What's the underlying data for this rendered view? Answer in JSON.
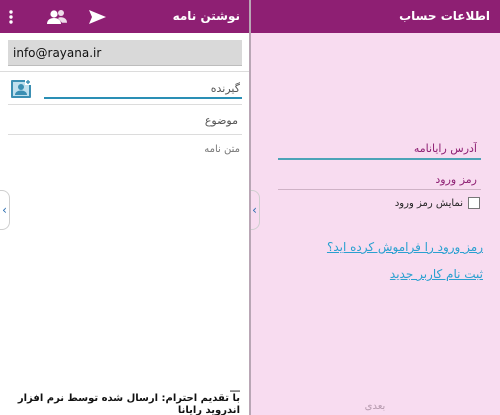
{
  "compose": {
    "title": "نوشتن نامه",
    "from_value": "info@rayana.ir",
    "to_placeholder": "گیرنده",
    "subject_placeholder": "موضوع",
    "body_placeholder": "متن نامه",
    "signature_line1": "__",
    "signature_line2": "با تقدیم احترام: ارسال شده توسط نرم افزار",
    "signature_line3": "اندروید رایانا"
  },
  "login": {
    "title": "اطلاعات حساب",
    "email_placeholder": "آدرس رایانامه",
    "password_placeholder": "رمز ورود",
    "show_password_label": "نمایش رمز ورود",
    "forgot_link": "رمز ورود را فراموش کرده اید؟",
    "register_link": "ثبت نام کاربر جدید",
    "next_button": "بعدی"
  },
  "edge_tab_glyph": "‹",
  "colors": {
    "appbar": "#8e1f73",
    "login_bg": "#f8dcf0",
    "link": "#2aa0d0",
    "accent_underline": "#2a8fb5"
  },
  "icons": [
    "overflow-menu-icon",
    "contacts-icon",
    "send-icon",
    "contact-card-icon",
    "chevron-left-icon"
  ]
}
